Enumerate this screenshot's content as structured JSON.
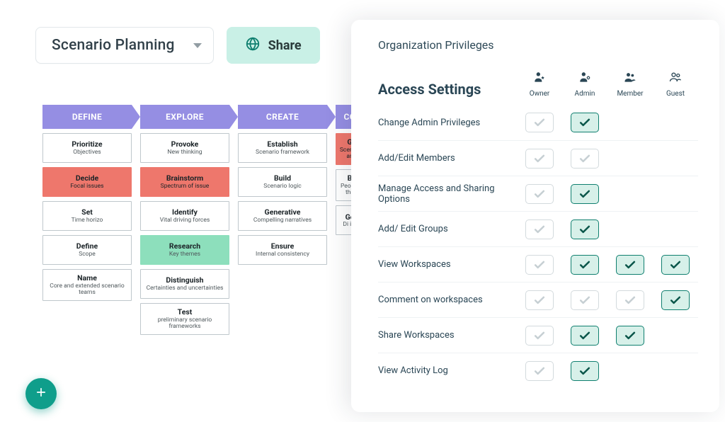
{
  "header": {
    "title": "Scenario Planning",
    "share_label": "Share"
  },
  "board": {
    "columns": [
      {
        "header": "DEFINE",
        "cards": [
          {
            "title": "Prioritize",
            "subtitle": "Objectives",
            "style": "plain"
          },
          {
            "title": "Decide",
            "subtitle": "Focal issues",
            "style": "red"
          },
          {
            "title": "Set",
            "subtitle": "Time horizo",
            "style": "plain"
          },
          {
            "title": "Define",
            "subtitle": "Scope",
            "style": "plain"
          },
          {
            "title": "Name",
            "subtitle": "Core and extended scenario teams",
            "style": "plain"
          }
        ]
      },
      {
        "header": "EXPLORE",
        "cards": [
          {
            "title": "Provoke",
            "subtitle": "New thinking",
            "style": "plain"
          },
          {
            "title": "Brainstorm",
            "subtitle": "Spectrum of issue",
            "style": "red"
          },
          {
            "title": "Identify",
            "subtitle": "Vital driving forces",
            "style": "plain"
          },
          {
            "title": "Research",
            "subtitle": "Key themes",
            "style": "green"
          },
          {
            "title": "Distinguish",
            "subtitle": "Certainties and uncertainties",
            "style": "plain"
          },
          {
            "title": "Test",
            "subtitle": "preliminary scenario frameworks",
            "style": "plain"
          }
        ]
      },
      {
        "header": "CREATE",
        "cards": [
          {
            "title": "Establish",
            "subtitle": "Scenario framework",
            "style": "plain"
          },
          {
            "title": "Build",
            "subtitle": "Scenario logic",
            "style": "plain"
          },
          {
            "title": "Generative",
            "subtitle": "Compelling narratives",
            "style": "plain"
          },
          {
            "title": "Ensure",
            "subtitle": "Internal consistency",
            "style": "plain"
          }
        ]
      },
      {
        "header": "CO",
        "cut": true,
        "cards": [
          {
            "title": "G",
            "subtitle": "Scenari an",
            "style": "red"
          },
          {
            "title": "B",
            "subtitle": "People the",
            "style": "plain"
          },
          {
            "title": "Ge",
            "subtitle": "Di im",
            "style": "plain"
          }
        ]
      }
    ]
  },
  "panel": {
    "title": "Organization Privileges",
    "section": "Access Settings",
    "roles": [
      "Owner",
      "Admin",
      "Member",
      "Guest"
    ],
    "rows": [
      {
        "name": "Change Admin Privileges",
        "cells": [
          "off",
          "on",
          "",
          ""
        ]
      },
      {
        "name": "Add/Edit Members",
        "cells": [
          "off",
          "off",
          "",
          ""
        ]
      },
      {
        "name": "Manage Access and Sharing Options",
        "cells": [
          "off",
          "on",
          "",
          ""
        ]
      },
      {
        "name": "Add/ Edit Groups",
        "cells": [
          "off",
          "on",
          "",
          ""
        ]
      },
      {
        "name": "View Workspaces",
        "cells": [
          "off",
          "on",
          "on",
          "on"
        ]
      },
      {
        "name": "Comment on workspaces",
        "cells": [
          "off",
          "off",
          "off",
          "on"
        ]
      },
      {
        "name": "Share Workspaces",
        "cells": [
          "off",
          "on",
          "on",
          ""
        ]
      },
      {
        "name": "View Activity Log",
        "cells": [
          "off",
          "on",
          "",
          ""
        ]
      }
    ]
  },
  "icons": {
    "globe": "globe-icon",
    "plus": "plus-icon"
  }
}
